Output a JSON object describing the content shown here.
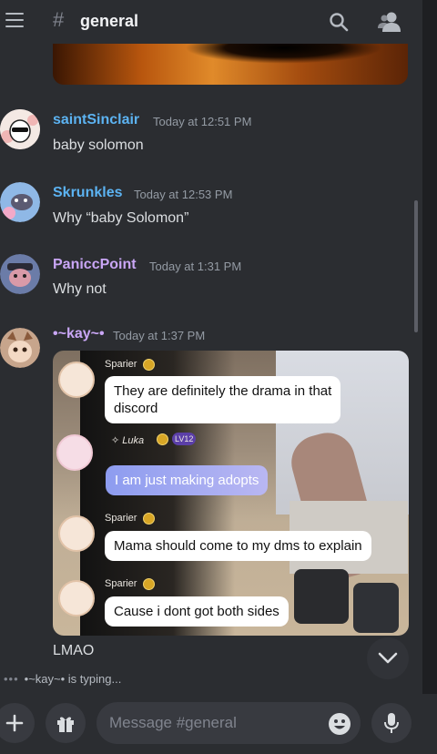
{
  "header": {
    "channel_hash": "#",
    "channel_name": "general",
    "menu_icon": "hamburger-icon",
    "search_icon": "search-icon",
    "members_icon": "members-icon"
  },
  "messages": [
    {
      "username": "saintSinclair",
      "timestamp": "Today at 12:51 PM",
      "text": "baby solomon",
      "name_color": "#5cb3f2"
    },
    {
      "username": "Skrunkles",
      "timestamp": "Today at 12:53 PM",
      "text": "Why “baby Solomon”",
      "name_color": "#5cb3f2"
    },
    {
      "username": "PaniccPoint",
      "timestamp": "Today at 1:31 PM",
      "text": "Why not",
      "name_color": "#c9a6f5"
    },
    {
      "username": "•~kay~•",
      "timestamp": "Today at 1:37 PM",
      "text": "LMAO",
      "name_color": "#c9a6f5"
    }
  ],
  "embed": {
    "posts": [
      {
        "name": "Sparier",
        "text_line1": "They are definitely the drama in that",
        "text_line2": "discord"
      },
      {
        "name": "✧ Luka",
        "level": "LV12",
        "text_line1": "I am just making adopts"
      },
      {
        "name": "Sparier",
        "text_line1": "Mama should come to my dms to explain"
      },
      {
        "name": "Sparier",
        "text_line1": "Cause i dont got both sides"
      }
    ]
  },
  "typing": {
    "dots": "•••",
    "text": "•~kay~• is typing..."
  },
  "composer": {
    "placeholder": "Message #general",
    "add_icon": "plus-icon",
    "gift_icon": "gift-icon",
    "emoji_icon": "emoji-icon",
    "mic_icon": "microphone-icon"
  },
  "colors": {
    "background": "#2b2d31",
    "accent_blue": "#5cb3f2",
    "accent_purple": "#c9a6f5"
  }
}
